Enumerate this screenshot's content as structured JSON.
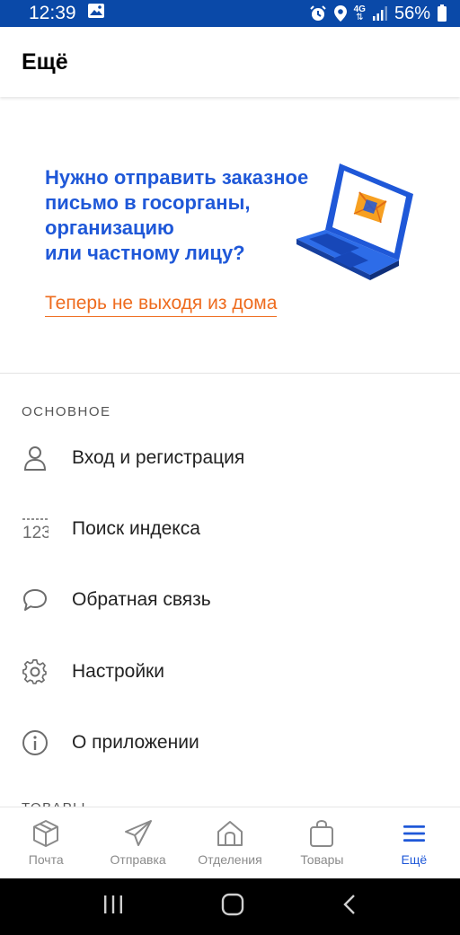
{
  "status_bar": {
    "time": "12:39",
    "network": "4G",
    "battery": "56%",
    "icons": [
      "image-icon",
      "alarm-icon",
      "location-icon",
      "network-4g-icon",
      "signal-icon",
      "battery-icon"
    ]
  },
  "header": {
    "title": "Ещё"
  },
  "promo": {
    "line1": "Нужно отправить заказное",
    "line2": "письмо в госорганы,",
    "line3": "организацию",
    "line4": "или частному лицу?",
    "link": "Теперь не выходя из дома"
  },
  "section_main": {
    "title": "ОСНОВНОЕ"
  },
  "menu": {
    "items": [
      {
        "label": "Вход и регистрация",
        "icon": "user-icon"
      },
      {
        "label": "Поиск индекса",
        "icon": "postcode-icon"
      },
      {
        "label": "Обратная связь",
        "icon": "chat-bubble-icon"
      },
      {
        "label": "Настройки",
        "icon": "gear-icon"
      },
      {
        "label": "О приложении",
        "icon": "info-icon"
      }
    ]
  },
  "section_goods": {
    "title": "ТОВАРЫ"
  },
  "bottom_nav": {
    "items": [
      {
        "label": "Почта",
        "icon": "package-icon"
      },
      {
        "label": "Отправка",
        "icon": "paper-plane-icon"
      },
      {
        "label": "Отделения",
        "icon": "post-office-icon"
      },
      {
        "label": "Товары",
        "icon": "shopping-bag-icon"
      },
      {
        "label": "Ещё",
        "icon": "menu-icon",
        "active": true
      }
    ]
  },
  "colors": {
    "status_bar": "#0a49a8",
    "primary_blue": "#1f58d8",
    "accent_orange": "#ee6c1f",
    "inactive_gray": "#8a8a8a"
  }
}
